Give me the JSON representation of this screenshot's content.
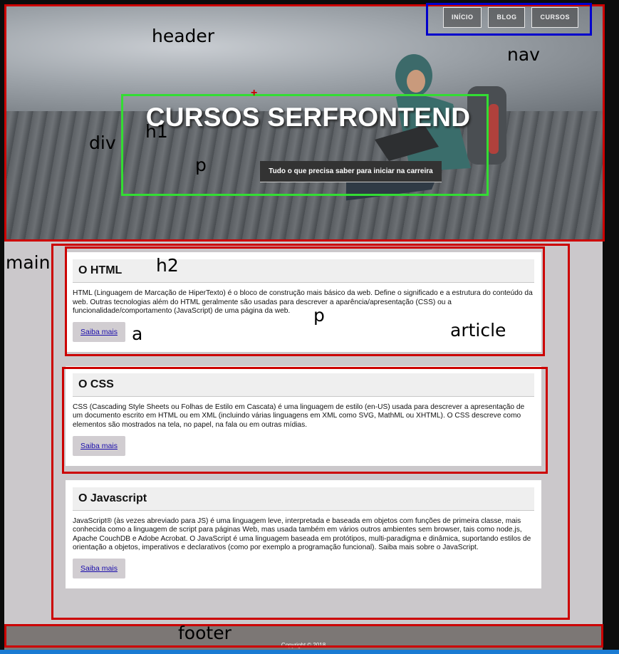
{
  "header": {
    "nav": [
      "INÍCIO",
      "BLOG",
      "CURSOS"
    ],
    "title": "CURSOS SERFRONTEND",
    "subtitle": "Tudo o que precisa saber para iniciar na carreira"
  },
  "articles": [
    {
      "title": "O HTML",
      "text": "HTML (Linguagem de Marcação de HiperTexto) é o bloco de construção mais básico da web. Define o significado e a estrutura do conteúdo da web. Outras tecnologias além do HTML geralmente são usadas para descrever a aparência/apresentação (CSS) ou a funcionalidade/comportamento (JavaScript) de uma página da web.",
      "link": "Saiba mais"
    },
    {
      "title": "O CSS",
      "text": "CSS (Cascading Style Sheets ou Folhas de Estilo em Cascata) é uma linguagem de estilo (en-US) usada para descrever a apresentação de um documento escrito em HTML ou em XML (incluindo várias linguagens em XML como SVG, MathML ou XHTML). O CSS descreve como elementos são mostrados na tela, no papel, na fala ou em outras mídias.",
      "link": "Saiba mais"
    },
    {
      "title": "O Javascript",
      "text": "JavaScript® (às vezes abreviado para JS) é uma linguagem leve, interpretada e baseada em objetos com funções de primeira classe, mais conhecida como a linguagem de script para páginas Web, mas usada também em vários outros ambientes sem browser, tais como node.js, Apache CouchDB e Adobe Acrobat. O JavaScript é uma linguagem baseada em protótipos, multi-paradigma e dinâmica, suportando estilos de orientação a objetos, imperativos e declarativos (como por exemplo a programação funcional). Saiba mais sobre o JavaScript.",
      "link": "Saiba mais"
    }
  ],
  "footer": {
    "text": "Copyright © 2018"
  },
  "annotations": {
    "header": "header",
    "nav": "nav",
    "div": "div",
    "h1": "h1",
    "p1": "p",
    "main": "main",
    "h2": "h2",
    "p2": "p",
    "a": "a",
    "article": "article",
    "footer": "footer"
  },
  "colors": {
    "annotation_red": "#cc0000",
    "annotation_blue": "#0000cc",
    "annotation_green": "#33dd33",
    "link": "#1a0dab"
  }
}
